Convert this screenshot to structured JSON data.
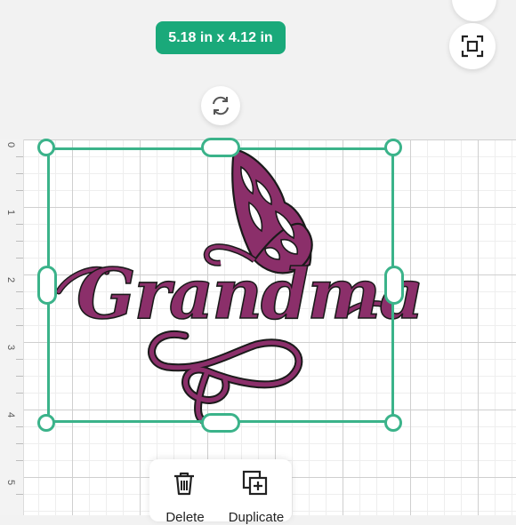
{
  "size_badge": {
    "label": "5.18 in x 4.12 in"
  },
  "icons": {
    "rotate": "rotate-icon",
    "fit": "fit-to-screen-icon",
    "delete": "trash-icon",
    "duplicate": "duplicate-icon"
  },
  "ruler": {
    "labels": [
      "0",
      "1",
      "2",
      "3",
      "4",
      "5"
    ]
  },
  "design": {
    "text": "Grandma",
    "color": "#8b2f6a"
  },
  "actions": [
    {
      "label": "Delete"
    },
    {
      "label": "Duplicate"
    }
  ],
  "colors": {
    "accent": "#1aa97a",
    "selection": "#3bb38a"
  }
}
